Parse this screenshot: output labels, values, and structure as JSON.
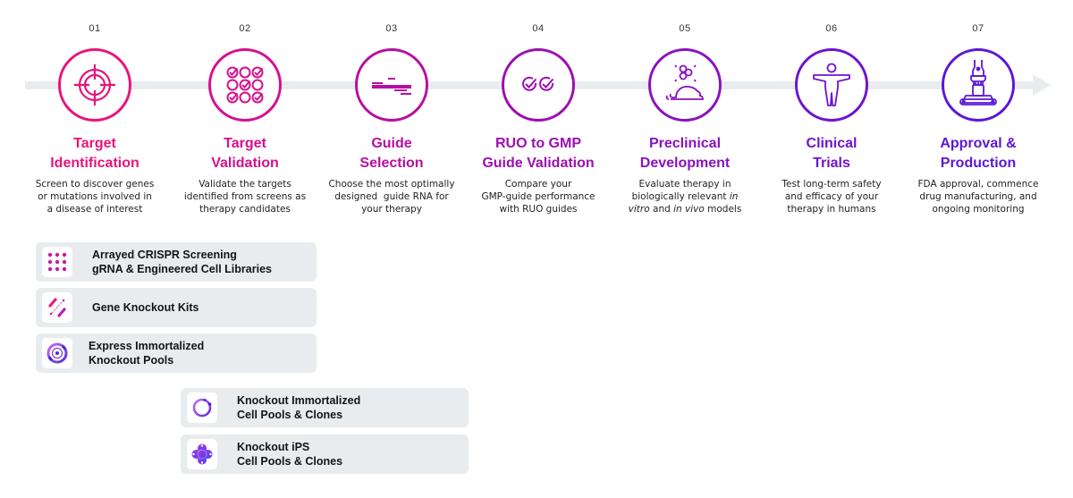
{
  "steps": [
    {
      "num": "01",
      "title": [
        "Target",
        "Identification"
      ],
      "desc": [
        "Screen to discover genes",
        "or mutations involved in",
        "a disease of interest"
      ],
      "icon": "target-crosshair-icon",
      "color": "#e8147a"
    },
    {
      "num": "02",
      "title": [
        "Target",
        "Validation"
      ],
      "desc": [
        "Validate the targets",
        "identified from screens as",
        "therapy candidates"
      ],
      "icon": "checklist-grid-icon",
      "color": "#d4118f"
    },
    {
      "num": "03",
      "title": [
        "Guide",
        "Selection"
      ],
      "desc": [
        "Choose the most optimally",
        "designed  guide RNA for",
        "your therapy"
      ],
      "icon": "guide-lines-icon",
      "color": "#b80fa0"
    },
    {
      "num": "04",
      "title": [
        "RUO to GMP",
        "Guide Validation"
      ],
      "desc": [
        "Compare your",
        "GMP-guide performance",
        "with RUO guides"
      ],
      "icon": "double-check-icon",
      "color": "#9d0fb0"
    },
    {
      "num": "05",
      "title": [
        "Preclinical",
        "Development"
      ],
      "desc_html": [
        "Evaluate therapy in",
        "biologically relevant <em>in</em>",
        "<em>vitro</em> and <em>in vivo</em> models"
      ],
      "icon": "mouse-cells-icon",
      "color": "#8a12bf"
    },
    {
      "num": "06",
      "title": [
        "Clinical",
        "Trials"
      ],
      "desc": [
        "Test long-term safety",
        "and efficacy of your",
        "therapy in humans"
      ],
      "icon": "human-figure-icon",
      "color": "#6f13cf"
    },
    {
      "num": "07",
      "title": [
        "Approval &",
        "Production"
      ],
      "desc": [
        "FDA approval, commence",
        "drug manufacturing, and",
        "ongoing monitoring"
      ],
      "icon": "robot-arm-conveyor-icon",
      "color": "#5b18d8"
    }
  ],
  "products": [
    {
      "lines": [
        "Arrayed CRISPR Screening",
        "gRNA & Engineered Cell Libraries"
      ],
      "icon": "array-grid-icon"
    },
    {
      "lines": [
        "Gene Knockout Kits"
      ],
      "icon": "knockout-kit-icon"
    },
    {
      "lines": [
        "Express Immortalized",
        "Knockout Pools"
      ],
      "icon": "express-pools-icon"
    },
    {
      "lines": [
        "Knockout Immortalized",
        "Cell Pools & Clones"
      ],
      "icon": "ring-cells-icon"
    },
    {
      "lines": [
        "Knockout iPS",
        "Cell Pools & Clones"
      ],
      "icon": "ips-cluster-icon"
    }
  ]
}
